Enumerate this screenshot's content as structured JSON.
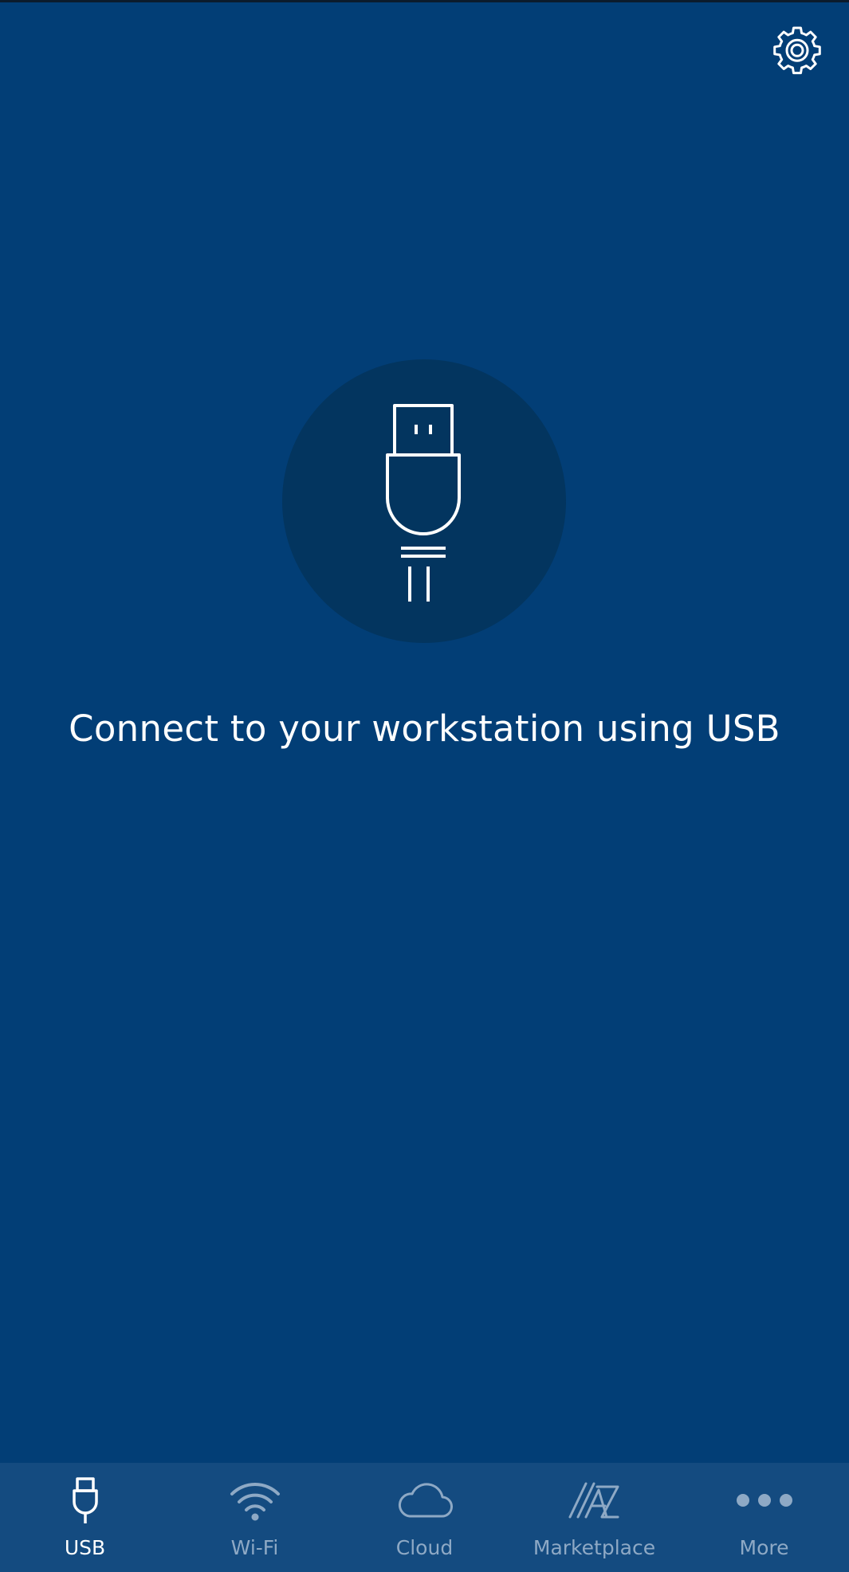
{
  "header": {
    "settings_icon": "gear-icon"
  },
  "main": {
    "hero_icon": "usb-plug-icon",
    "message": "Connect to your workstation using USB"
  },
  "tab_bar": {
    "tabs": [
      {
        "label": "USB",
        "icon": "usb-icon",
        "active": true
      },
      {
        "label": "Wi-Fi",
        "icon": "wifi-icon",
        "active": false
      },
      {
        "label": "Cloud",
        "icon": "cloud-icon",
        "active": false
      },
      {
        "label": "Marketplace",
        "icon": "marketplace-icon",
        "active": false
      },
      {
        "label": "More",
        "icon": "more-dots-icon",
        "active": false
      }
    ]
  },
  "colors": {
    "background": "#023e76",
    "hero_circle": "#03355f",
    "tab_bar": "#144b80",
    "active": "#ffffff",
    "inactive": "#8ea9c5"
  }
}
